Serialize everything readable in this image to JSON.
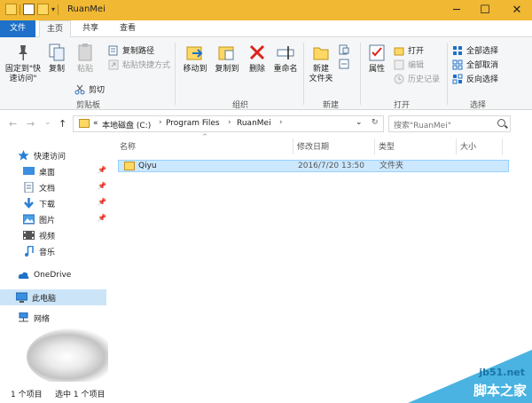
{
  "window": {
    "title": "RuanMei",
    "minimize": "─",
    "maximize": "☐",
    "close": "✕",
    "quick_dropdown": "▾"
  },
  "tabs": [
    {
      "label": "文件"
    },
    {
      "label": "主页"
    },
    {
      "label": "共享"
    },
    {
      "label": "查看"
    }
  ],
  "ribbon": {
    "pin_label": "固定到\"快速访问\"",
    "copy_label": "复制",
    "paste_label": "粘贴",
    "copy_path_label": "复制路径",
    "paste_shortcut_label": "粘贴快捷方式",
    "cut_label": "剪切",
    "move_to_label": "移动到",
    "copy_to_label": "复制到",
    "delete_label": "删除",
    "rename_label": "重命名",
    "new_folder_label": "新建\n文件夹",
    "properties_label": "属性",
    "open_label": "打开",
    "edit_label": "编辑",
    "history_label": "历史记录",
    "select_all_label": "全部选择",
    "select_none_label": "全部取消",
    "invert_selection_label": "反向选择",
    "groups": {
      "clipboard": "剪贴板",
      "organize": "组织",
      "new": "新建",
      "open": "打开",
      "select": "选择"
    },
    "accent": "#1e70c8"
  },
  "address": {
    "prefix": "«",
    "crumbs": [
      "本地磁盘 (C:)",
      "Program Files",
      "RuanMei"
    ],
    "separator": "›",
    "search_placeholder": "搜索\"RuanMei\""
  },
  "nav_buttons": {
    "back": "←",
    "forward": "→",
    "recent": "⌄",
    "up": "↑",
    "dropdown": "⌄",
    "refresh": "↻"
  },
  "sidebar": {
    "items": [
      {
        "label": "快速访问",
        "icon": "star-icon"
      },
      {
        "label": "桌面",
        "icon": "desktop-icon",
        "pinned": true
      },
      {
        "label": "文档",
        "icon": "documents-icon",
        "pinned": true
      },
      {
        "label": "下载",
        "icon": "download-icon",
        "pinned": true
      },
      {
        "label": "图片",
        "icon": "pictures-icon",
        "pinned": true
      },
      {
        "label": "视频",
        "icon": "videos-icon"
      },
      {
        "label": "音乐",
        "icon": "music-icon"
      },
      {
        "label": "OneDrive",
        "icon": "cloud-icon"
      },
      {
        "label": "此电脑",
        "icon": "computer-icon",
        "selected": true
      },
      {
        "label": "网络",
        "icon": "network-icon"
      }
    ],
    "pin_glyph": "📌"
  },
  "file_list": {
    "columns": [
      "名称",
      "修改日期",
      "类型",
      "大小"
    ],
    "sort_glyph": "^",
    "rows": [
      {
        "name": "Qiyu",
        "modified": "2016/7/20 13:50",
        "type": "文件夹",
        "size": ""
      }
    ]
  },
  "status": {
    "item_count": "1 个项目",
    "selected": "选中 1 个项目"
  },
  "watermark": {
    "site": "jb51.net",
    "brand": "脚本之家"
  }
}
